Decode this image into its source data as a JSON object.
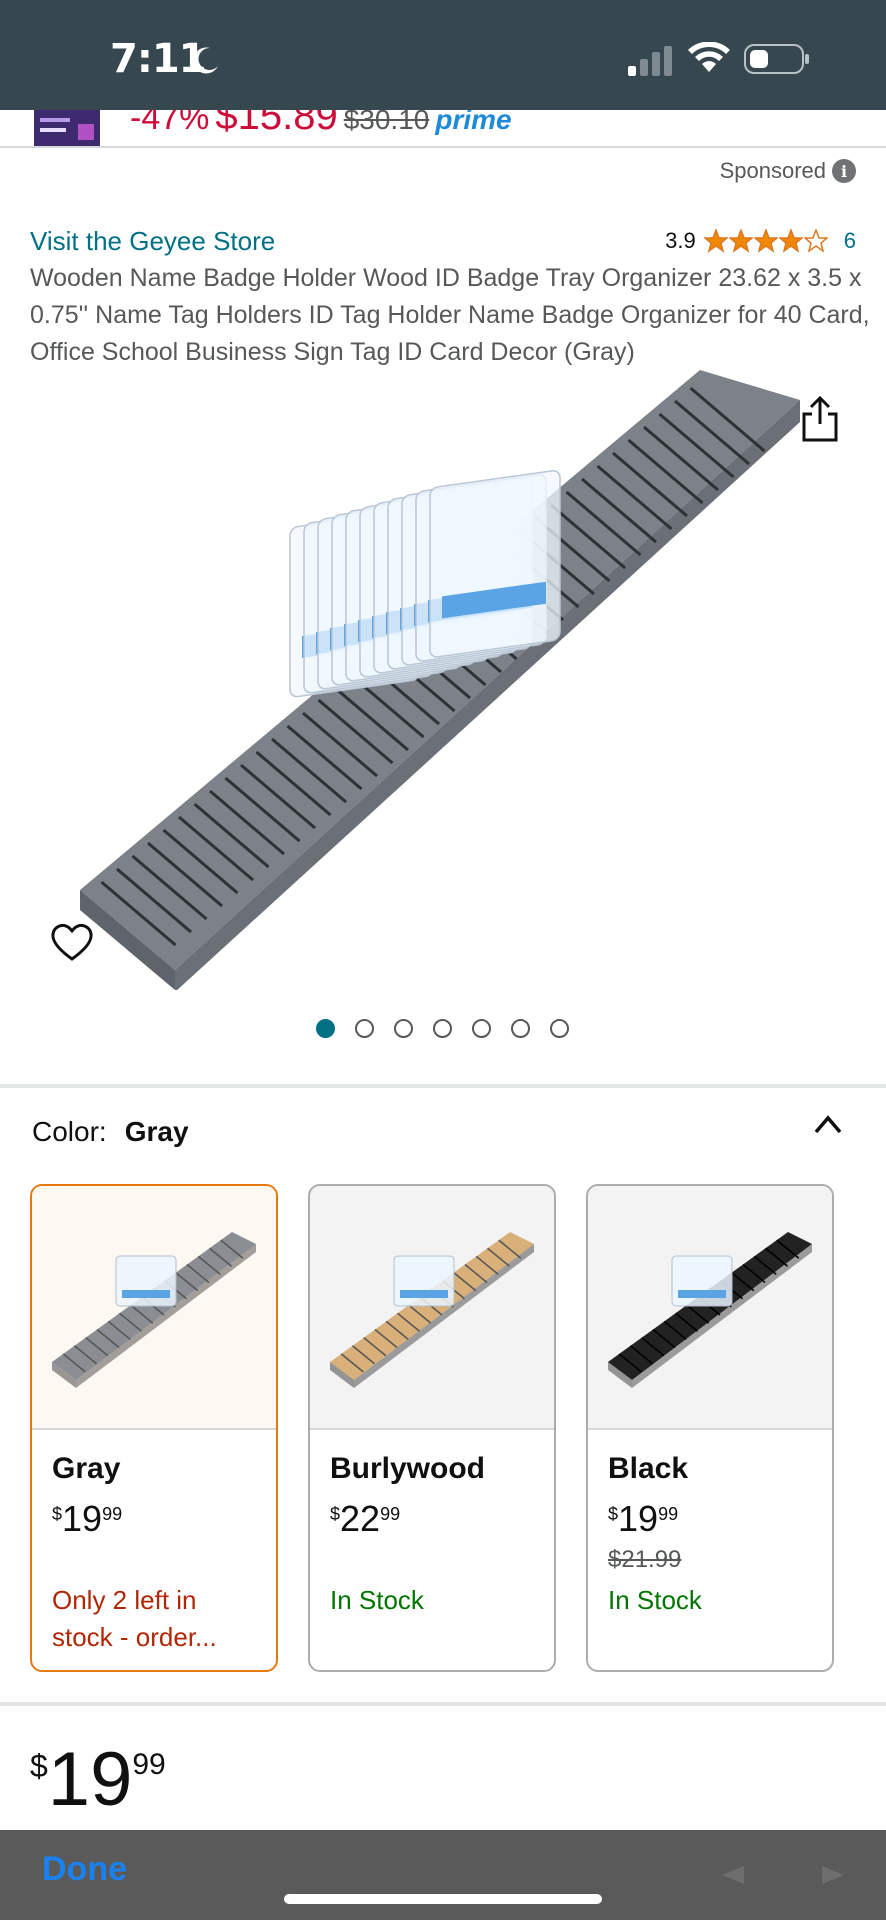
{
  "status_bar": {
    "time": "7:11"
  },
  "ad": {
    "discount": "-47%",
    "price": "$15.89",
    "was_price": "$30.10",
    "badge": "prime"
  },
  "sponsored_label": "Sponsored",
  "product": {
    "store_link": "Visit the Geyee Store",
    "rating": "3.9",
    "rating_count": "6",
    "stars": 3.9,
    "title": "Wooden Name Badge Holder Wood ID Badge Tray Organizer 23.62 x 3.5 x 0.75'' Name Tag Holders ID Tag Holder Name Badge Organizer for 40 Card, Office School Business Sign Tag ID Card Decor (Gray)",
    "image_count": 7,
    "active_image": 1
  },
  "color_selector": {
    "label": "Color:",
    "value": "Gray"
  },
  "swatches": [
    {
      "name": "Gray",
      "currency": "$",
      "whole": "19",
      "fraction": "99",
      "was": "",
      "stock": "Only 2 left in stock - order...",
      "tray_color": "#8a8e93"
    },
    {
      "name": "Burlywood",
      "currency": "$",
      "whole": "22",
      "fraction": "99",
      "was": "",
      "stock": "In Stock",
      "tray_color": "#d9b07a"
    },
    {
      "name": "Black",
      "currency": "$",
      "whole": "19",
      "fraction": "99",
      "was": "$21.99",
      "stock": "In Stock",
      "tray_color": "#222222"
    }
  ],
  "price": {
    "currency": "$",
    "whole": "19",
    "fraction": "99"
  },
  "bottom_bar": {
    "done_label": "Done"
  },
  "colors": {
    "link": "#007185",
    "deal_red": "#cc0c39",
    "stock_red": "#b12704",
    "stock_green": "#007600",
    "selected_border": "#e47911",
    "star": "#f08804"
  }
}
